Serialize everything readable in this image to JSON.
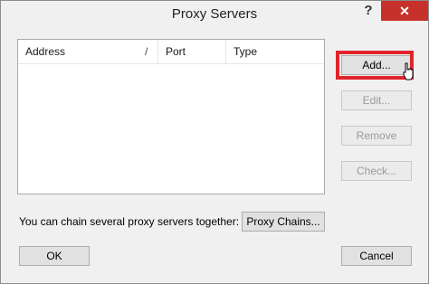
{
  "window": {
    "title": "Proxy Servers",
    "help_label": "?",
    "close_label": "✕"
  },
  "list": {
    "columns": [
      "Address",
      "Port",
      "Type"
    ],
    "sort_glyph": "/"
  },
  "buttons": {
    "add": "Add...",
    "edit": "Edit...",
    "remove": "Remove",
    "check": "Check...",
    "proxy_chains": "Proxy Chains...",
    "ok": "OK",
    "cancel": "Cancel"
  },
  "chain_text": "You can chain several proxy servers together:",
  "colors": {
    "highlight": "#e0242b",
    "close": "#c7312b"
  }
}
